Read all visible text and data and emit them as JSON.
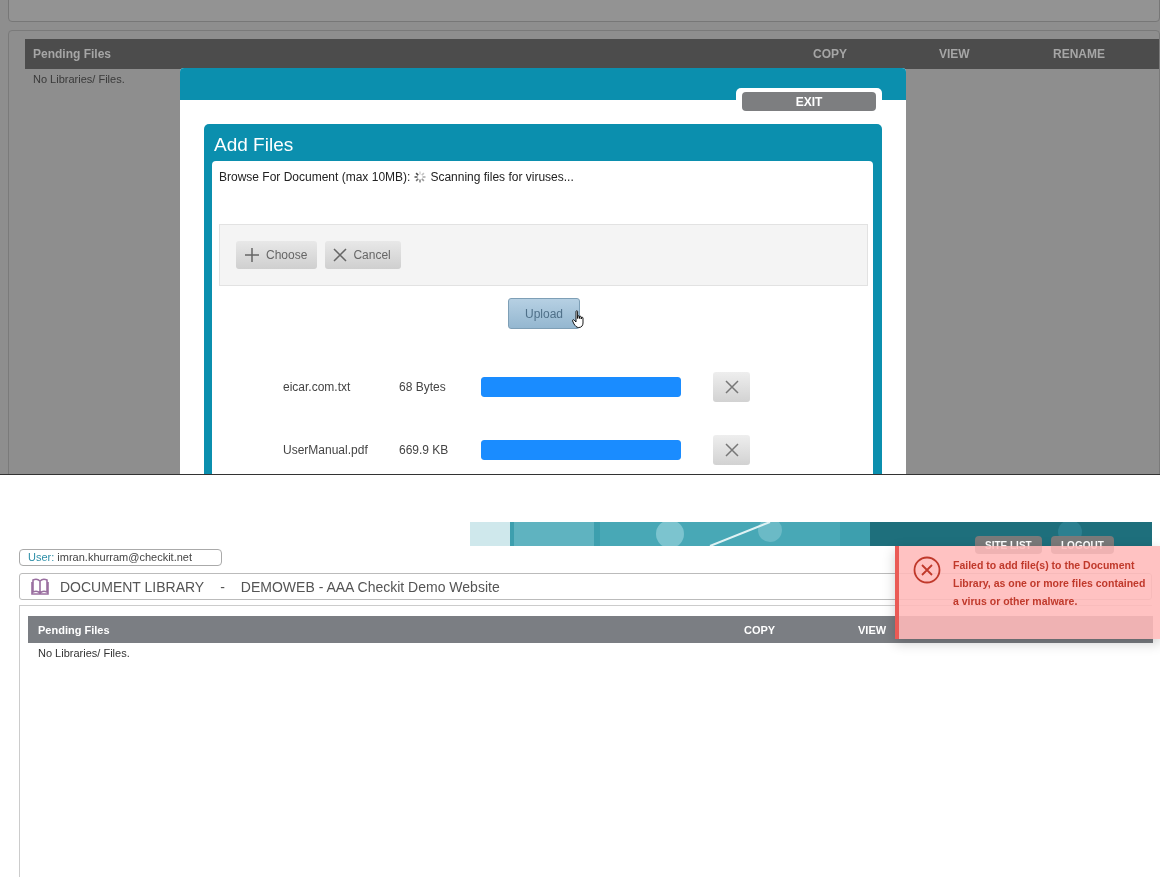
{
  "background_page": {
    "table": {
      "columns": [
        "Pending Files",
        "COPY",
        "VIEW",
        "RENAME"
      ],
      "empty_text": "No Libraries/ Files."
    }
  },
  "modal": {
    "exit_button": "EXIT",
    "title": "Add Files",
    "browse_label": "Browse For Document (max 10MB):",
    "status": "Scanning files for viruses...",
    "toolbar": [
      {
        "label": "Choose",
        "kind": "add"
      },
      {
        "label": "Cancel",
        "kind": "cancel"
      }
    ],
    "upload_button": {
      "label": "Upload",
      "disabled": true
    },
    "files": [
      {
        "name": "eicar.com.txt",
        "size": "68 Bytes",
        "level": 1
      },
      {
        "name": "UserManual.pdf",
        "size": "669.9 KB",
        "level": 1
      }
    ]
  },
  "result_page": {
    "user_label": "User:",
    "user": "imran.khurram@checkit.net",
    "header_buttons": [
      "SITE LIST",
      "LOGOUT"
    ],
    "breadcrumb": [
      "DOCUMENT LIBRARY",
      "-",
      "DEMOWEB - AAA Checkit Demo Website"
    ],
    "table": {
      "columns": [
        "Pending Files",
        "COPY",
        "VIEW"
      ],
      "empty_text": "No Libraries/ Files."
    },
    "toast": {
      "kind": "error",
      "message": "Failed to add file(s) to the Document Library, as one or more files contained a virus or other malware."
    }
  }
}
